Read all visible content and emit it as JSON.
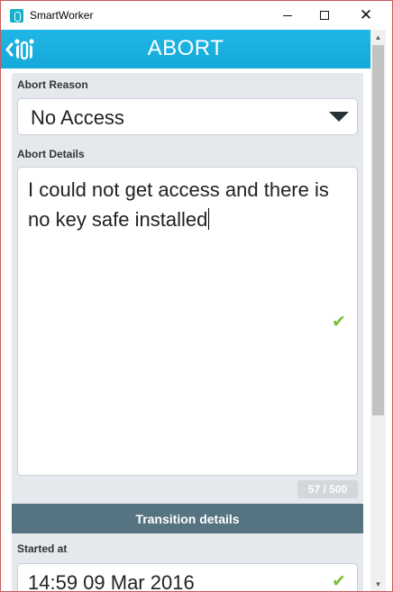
{
  "window": {
    "title": "SmartWorker",
    "controls": {
      "minimize": "minimize-icon",
      "maximize": "maximize-icon",
      "close": "close-icon"
    }
  },
  "header": {
    "title": "ABORT",
    "back_icon": "back-logo-icon",
    "color": "#1ab0e0"
  },
  "form": {
    "abort_reason": {
      "label": "Abort Reason",
      "value": "No Access"
    },
    "abort_details": {
      "label": "Abort Details",
      "value": "I could not get access and there is no key safe installed",
      "counter": "57 / 500"
    },
    "transition_details": {
      "header": "Transition details",
      "started_at_label": "Started at",
      "started_at_value": "14:59 09 Mar 2016"
    }
  },
  "colors": {
    "accent": "#1ab0e0",
    "section_bar": "#557380",
    "valid_check": "#7ac036",
    "card_background": "#e5e9ed"
  }
}
